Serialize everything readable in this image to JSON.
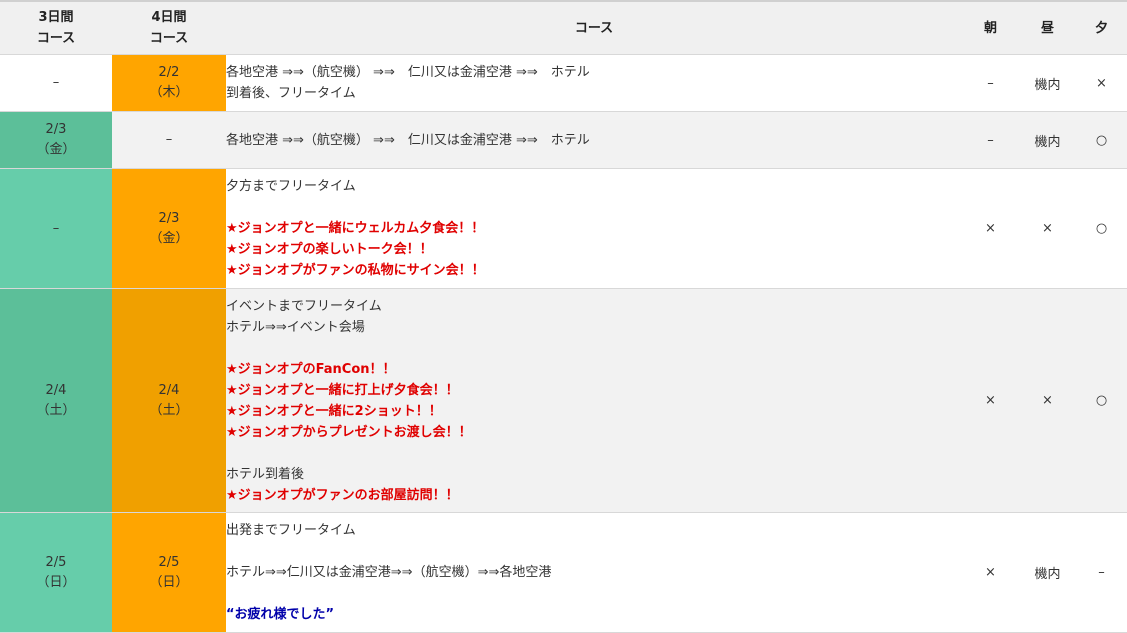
{
  "header": {
    "col3": [
      "3日間",
      "コース"
    ],
    "col4": [
      "4日間",
      "コース"
    ],
    "course": "コース",
    "breakfast": "朝",
    "lunch": "昼",
    "dinner": "夕"
  },
  "rows": [
    {
      "c3": [
        "–"
      ],
      "c4": [
        "2/2",
        "（木）"
      ],
      "lines": [
        {
          "t": "各地空港 ⇒⇒（航空機） ⇒⇒　仁川又は金浦空港 ⇒⇒　ホテル",
          "s": "normal"
        },
        {
          "t": "到着後、フリータイム",
          "s": "normal"
        }
      ],
      "meals": [
        "–",
        "機内",
        "×"
      ]
    },
    {
      "c3": [
        "2/3",
        "（金）"
      ],
      "c4": [
        "–"
      ],
      "lines": [
        {
          "t": "各地空港 ⇒⇒（航空機） ⇒⇒　仁川又は金浦空港 ⇒⇒　ホテル",
          "s": "normal"
        }
      ],
      "meals": [
        "–",
        "機内",
        "○"
      ]
    },
    {
      "c3": [
        "–"
      ],
      "c4": [
        "2/3",
        "（金）"
      ],
      "lines": [
        {
          "t": "夕方までフリータイム",
          "s": "normal"
        },
        {
          "t": "",
          "s": "blank"
        },
        {
          "t": "★ジョンオプと一緒にウェルカム夕食会！！",
          "s": "red"
        },
        {
          "t": "★ジョンオプの楽しいトーク会！！",
          "s": "red"
        },
        {
          "t": "★ジョンオプがファンの私物にサイン会！！",
          "s": "red"
        }
      ],
      "meals": [
        "×",
        "×",
        "○"
      ]
    },
    {
      "c3": [
        "2/4",
        "（土）"
      ],
      "c4": [
        "2/4",
        "（土）"
      ],
      "lines": [
        {
          "t": "イベントまでフリータイム",
          "s": "normal"
        },
        {
          "t": "ホテル⇒⇒イベント会場",
          "s": "normal"
        },
        {
          "t": "",
          "s": "blank"
        },
        {
          "t": "★ジョンオプのFanCon！！",
          "s": "red"
        },
        {
          "t": "★ジョンオプと一緒に打上げ夕食会！！",
          "s": "red"
        },
        {
          "t": "★ジョンオプと一緒に2ショット！！",
          "s": "red"
        },
        {
          "t": "★ジョンオプからプレゼントお渡し会！！",
          "s": "red"
        },
        {
          "t": "",
          "s": "blank"
        },
        {
          "t": "ホテル到着後",
          "s": "normal"
        },
        {
          "t": "★ジョンオプがファンのお部屋訪問！！",
          "s": "red"
        }
      ],
      "meals": [
        "×",
        "×",
        "○"
      ]
    },
    {
      "c3": [
        "2/5",
        "（日）"
      ],
      "c4": [
        "2/5",
        "（日）"
      ],
      "lines": [
        {
          "t": "出発までフリータイム",
          "s": "normal"
        },
        {
          "t": "",
          "s": "blank"
        },
        {
          "t": "ホテル⇒⇒仁川又は金浦空港⇒⇒（航空機）⇒⇒各地空港",
          "s": "normal"
        },
        {
          "t": "",
          "s": "blank"
        },
        {
          "t": "“お疲れ様でした”",
          "s": "blue"
        }
      ],
      "meals": [
        "×",
        "機内",
        "–"
      ]
    }
  ]
}
